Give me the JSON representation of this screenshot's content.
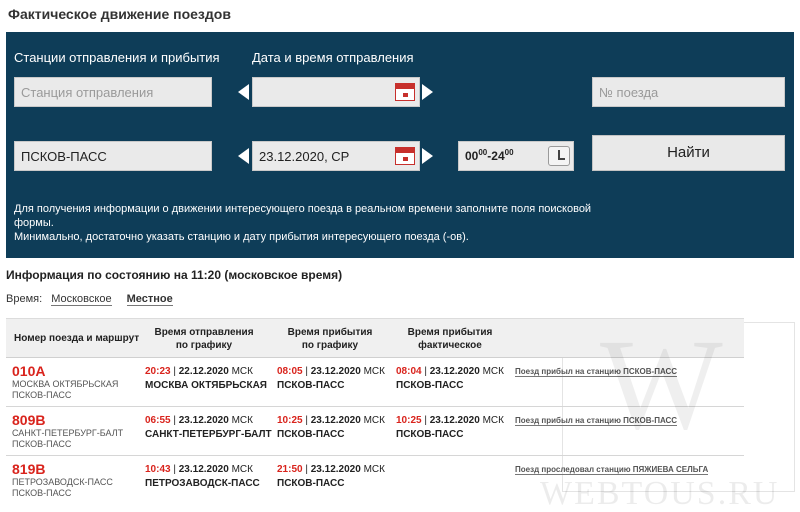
{
  "page_title": "Фактическое движение поездов",
  "search": {
    "label_stations": "Станции отправления и прибытия",
    "label_datetime": "Дата и время отправления",
    "departure_placeholder": "Станция отправления",
    "arrival_value": "ПСКОВ-ПАСС",
    "date_value": "23.12.2020, СР",
    "train_placeholder": "№ поезда",
    "time_from_main": "00",
    "time_from_sup": "00",
    "time_sep": "-",
    "time_to_main": "24",
    "time_to_sup": "00",
    "find_label": "Найти",
    "hint_line1": "Для получения информации о движении интересующего поезда в реальном времени заполните поля поисковой формы.",
    "hint_line2": "Минимально, достаточно указать станцию и дату прибытия интересующего поезда (-ов)."
  },
  "info": {
    "status_title": "Информация по состоянию на 11:20 (московское время)",
    "time_label": "Время:",
    "time_opt_moscow": "Московское",
    "time_opt_local": "Местное"
  },
  "table": {
    "headers": {
      "route": "Номер поезда и маршрут",
      "dep_line1": "Время отправления",
      "dep_line2": "по графику",
      "arr_line1": "Время прибытия",
      "arr_line2": "по графику",
      "fact_line1": "Время прибытия",
      "fact_line2": "фактическое"
    },
    "rows": [
      {
        "num": "010А",
        "route1": "МОСКВА ОКТЯБРЬСКАЯ",
        "route2": "ПСКОВ-ПАСС",
        "dep_time": "20:23",
        "dep_date": "22.12.2020",
        "dep_tz": "МСК",
        "dep_station": "МОСКВА ОКТЯБРЬСКАЯ",
        "arr_time": "08:05",
        "arr_date": "23.12.2020",
        "arr_tz": "МСК",
        "arr_station": "ПСКОВ-ПАСС",
        "fact_time": "08:04",
        "fact_date": "23.12.2020",
        "fact_tz": "МСК",
        "fact_station": "ПСКОВ-ПАСС",
        "status": "Поезд прибыл на станцию ПСКОВ-ПАСС"
      },
      {
        "num": "809В",
        "route1": "САНКТ-ПЕТЕРБУРГ-БАЛТ",
        "route2": "ПСКОВ-ПАСС",
        "dep_time": "06:55",
        "dep_date": "23.12.2020",
        "dep_tz": "МСК",
        "dep_station": "САНКТ-ПЕТЕРБУРГ-БАЛТ",
        "arr_time": "10:25",
        "arr_date": "23.12.2020",
        "arr_tz": "МСК",
        "arr_station": "ПСКОВ-ПАСС",
        "fact_time": "10:25",
        "fact_date": "23.12.2020",
        "fact_tz": "МСК",
        "fact_station": "ПСКОВ-ПАСС",
        "status": "Поезд прибыл на станцию ПСКОВ-ПАСС"
      },
      {
        "num": "819В",
        "route1": "ПЕТРОЗАВОДСК-ПАСС",
        "route2": "ПСКОВ-ПАСС",
        "dep_time": "10:43",
        "dep_date": "23.12.2020",
        "dep_tz": "МСК",
        "dep_station": "ПЕТРОЗАВОДСК-ПАСС",
        "arr_time": "21:50",
        "arr_date": "23.12.2020",
        "arr_tz": "МСК",
        "arr_station": "ПСКОВ-ПАСС",
        "status": "Поезд проследовал станцию ПЯЖИЕВА СЕЛЬГА"
      }
    ]
  },
  "watermark": {
    "letter": "W",
    "text": "WEBTOUS.RU"
  },
  "icons": {
    "calendar": "calendar-icon",
    "clock": "clock-icon",
    "arrow_left": "arrow-left-icon",
    "arrow_right": "arrow-right-icon"
  },
  "colors": {
    "panel_bg": "#0e3d58",
    "accent_red": "#d9231c"
  }
}
